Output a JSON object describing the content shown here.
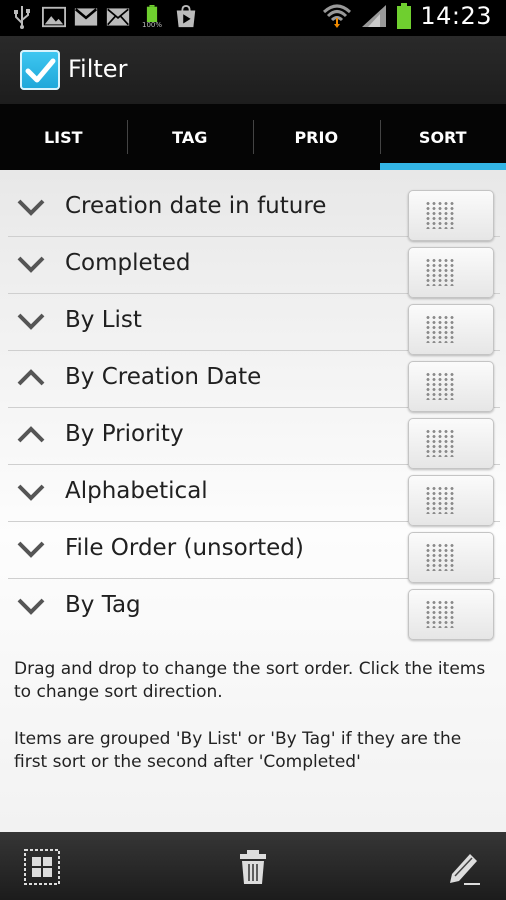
{
  "status_bar": {
    "time": "14:23",
    "battery_small_label": "100%",
    "icons": [
      "usb-icon",
      "gallery-icon",
      "gmail-icon",
      "email-icon",
      "battery-full-icon",
      "play-store-icon",
      "wifi-icon",
      "signal-icon",
      "battery-icon"
    ]
  },
  "action_bar": {
    "title": "Filter",
    "app_icon": "checkbox-icon"
  },
  "tabs": [
    {
      "label": "LIST",
      "active": false
    },
    {
      "label": "TAG",
      "active": false
    },
    {
      "label": "PRIO",
      "active": false
    },
    {
      "label": "SORT",
      "active": true
    }
  ],
  "sort_items": [
    {
      "label": "Creation date in future",
      "direction": "down"
    },
    {
      "label": "Completed",
      "direction": "down"
    },
    {
      "label": "By List",
      "direction": "down"
    },
    {
      "label": "By Creation Date",
      "direction": "up"
    },
    {
      "label": "By Priority",
      "direction": "up"
    },
    {
      "label": "Alphabetical",
      "direction": "down"
    },
    {
      "label": "File Order (unsorted)",
      "direction": "down"
    },
    {
      "label": "By Tag",
      "direction": "down"
    }
  ],
  "help": {
    "line1": "Drag and drop to change the sort order. Click the items to change sort direction.",
    "line2": "Items are grouped 'By List' or 'By Tag' if they are the first sort or the second after 'Completed'"
  },
  "bottom_bar": {
    "icons": [
      "select-all-icon",
      "trash-icon",
      "edit-icon"
    ]
  },
  "colors": {
    "accent": "#33b5e5",
    "background": "#f2f2f2",
    "text": "#202020"
  }
}
